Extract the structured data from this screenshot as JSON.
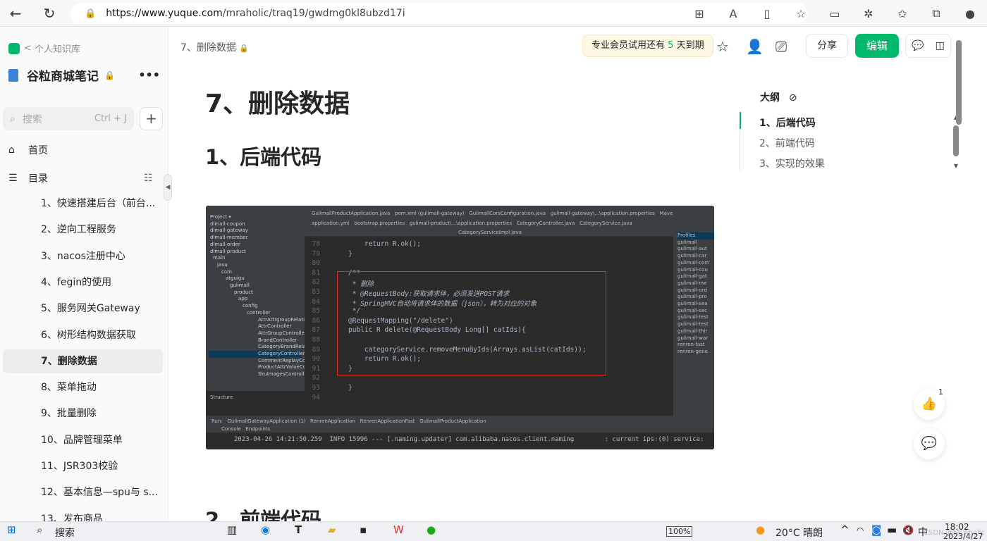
{
  "browser": {
    "url_host": "https://www.yuque.com",
    "url_path": "/mraholic/traq19/gwdmg0kl8ubzd17i"
  },
  "sidebar": {
    "breadcrumb": "个人知识库",
    "kb_title": "谷粒商城笔记",
    "search_placeholder": "搜索",
    "search_shortcut": "Ctrl + J",
    "home": "首页",
    "catalog": "目录",
    "items": [
      {
        "label": "1、快速搭建后台（前台..."
      },
      {
        "label": "2、逆向工程服务"
      },
      {
        "label": "3、nacos注册中心"
      },
      {
        "label": "4、fegin的使用"
      },
      {
        "label": "5、服务网关Gateway"
      },
      {
        "label": "6、树形结构数据获取"
      },
      {
        "label": "7、删除数据",
        "active": true
      },
      {
        "label": "8、菜单拖动"
      },
      {
        "label": "9、批量删除"
      },
      {
        "label": "10、品牌管理菜单"
      },
      {
        "label": "11、JSR303校验"
      },
      {
        "label": "12、基本信息—spu与 s..."
      },
      {
        "label": "13、发布商品"
      }
    ]
  },
  "header": {
    "doc_crumb": "7、删除数据",
    "trial_prefix": "专业会员试用还有",
    "trial_days": "5",
    "trial_suffix": "天到期",
    "share": "分享",
    "edit": "编辑"
  },
  "doc": {
    "title": "7、删除数据",
    "h2_1": "1、后端代码",
    "h2_2": "2、前端代码"
  },
  "outline": {
    "title": "大纲",
    "items": [
      "1、后端代码",
      "2、前端代码",
      "3、实现的效果"
    ],
    "active": 0
  },
  "code_image": {
    "tabs_row1": "GulimallProductApplication.java   pom.xml (gulimall-gateway)   GulimallCorsConfiguration.java   gulimall-gateway\\...\\application.properties   Maven",
    "tabs_row2": "application.yml   bootstrap.properties   gulimall-product\\...\\application.properties   CategoryController.java   CategoryService.java",
    "tab_file": "CategoryServiceImpl.java",
    "tree": [
      "Project ▾",
      "dlmall-coupon",
      "dlmall-gateway",
      "dlmall-member",
      "dlmall-order",
      "dlmall-product",
      "main",
      "java",
      "com",
      "atguigu",
      "gulimall",
      "product",
      "app",
      "config",
      "controller",
      "AttrAttrgroupRelation",
      "AttrController",
      "AttrGroupController",
      "BrandController",
      "CategoryBrandRelatio",
      "CategoryController",
      "CommentReplayCont",
      "ProductAttrValueCon",
      "SkuImagesController"
    ],
    "lines": [
      {
        "n": "78",
        "t": "    return R.ok();"
      },
      {
        "n": "79",
        "t": "}"
      },
      {
        "n": "80",
        "t": ""
      },
      {
        "n": "81",
        "t": "/**"
      },
      {
        "n": "82",
        "t": " * 删除"
      },
      {
        "n": "83",
        "t": " * @RequestBody:获取请求体，必须发送POST请求"
      },
      {
        "n": "84",
        "t": " * SpringMVC自动将请求体的数据（json），转为对应的对象"
      },
      {
        "n": "85",
        "t": " */"
      },
      {
        "n": "86",
        "t": "@RequestMapping(\"/delete\")"
      },
      {
        "n": "87",
        "t": "public R delete(@RequestBody Long[] catIds){"
      },
      {
        "n": "88",
        "t": ""
      },
      {
        "n": "89",
        "t": "    categoryService.removeMenuByIds(Arrays.asList(catIds));"
      },
      {
        "n": "90",
        "t": "    return R.ok();"
      },
      {
        "n": "91",
        "t": "}"
      },
      {
        "n": "92",
        "t": ""
      },
      {
        "n": "93",
        "t": "}"
      },
      {
        "n": "94",
        "t": ""
      }
    ],
    "maven": [
      "Profiles",
      "gulimall",
      "gulimall-aut",
      "gulimall-car",
      "gulimall-com",
      "gulimall-cou",
      "gulimall-gat",
      "gulimall-me",
      "gulimall-ord",
      "gulimall-pro",
      "gulimall-sea",
      "gulimall-sec",
      "gulimall-test",
      "gulimall-test",
      "gulimall-thir",
      "gulimall-war",
      "renren-fast",
      "renren-gene"
    ],
    "structure": "Structure",
    "run": "Run:   GulimallGatewayApplication (1)   RenrenApplication   RenrenApplicationFast   GulimallProductApplication",
    "console_tabs": "Console   Endpoints",
    "console": "2023-04-26 14:21:50.259  INFO 15996 --- [.naming.updater] com.alibaba.nacos.client.naming        : current ips:(0) service:"
  },
  "floating": {
    "like_count": "1"
  },
  "taskbar": {
    "search": "搜索",
    "battery": "100%",
    "weather": "20°C  晴朗",
    "ime": "中",
    "time": "18:02",
    "date": "2023/4/27",
    "watermark": "CSDN @Mr.Aholic"
  }
}
